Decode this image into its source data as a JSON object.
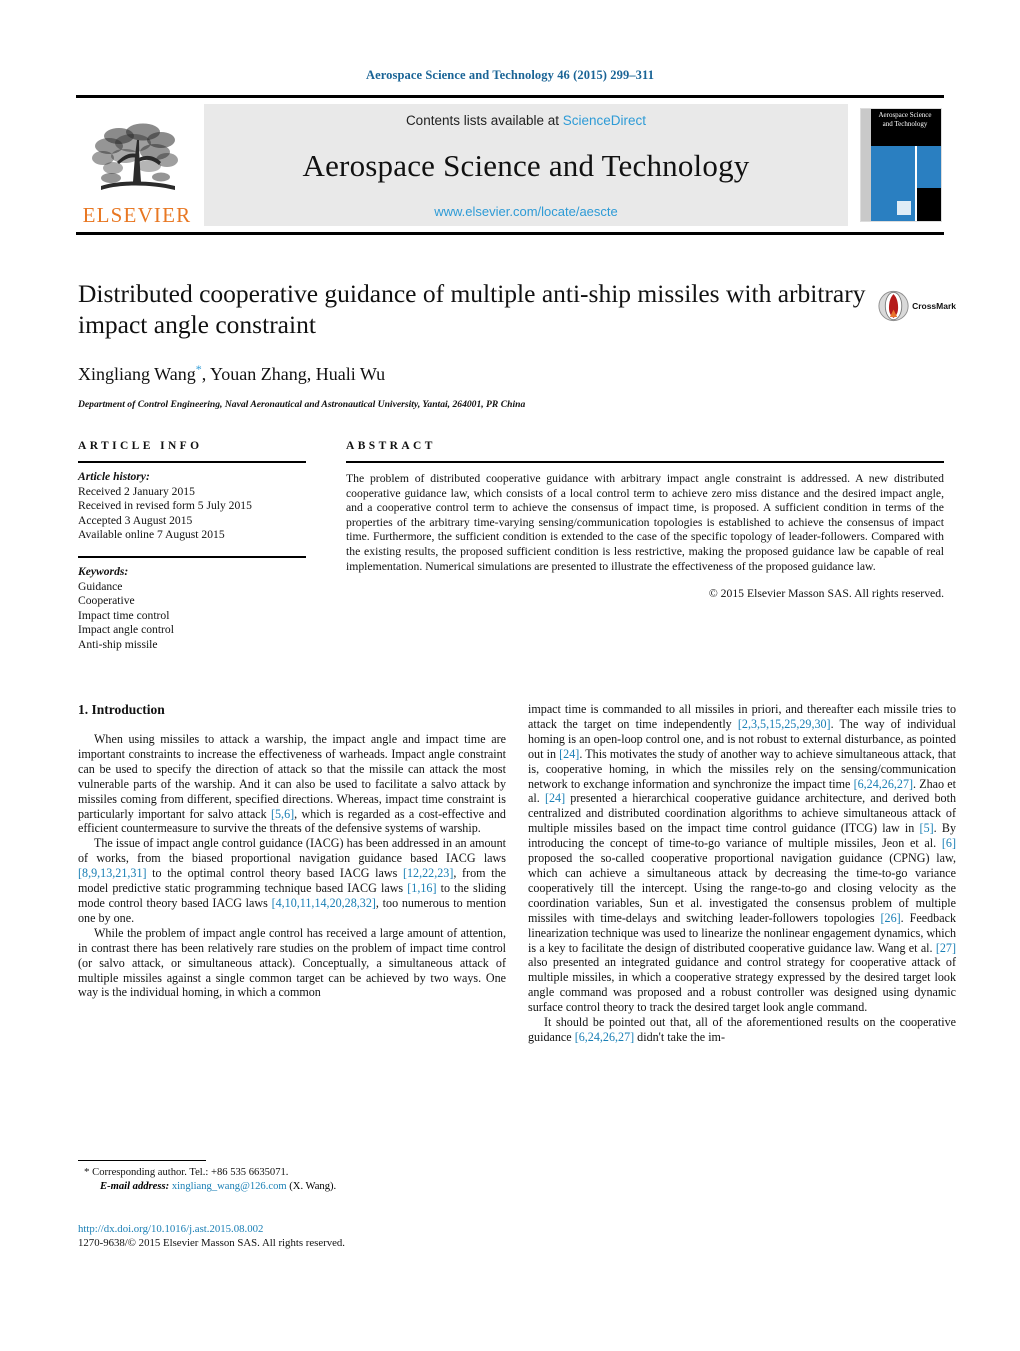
{
  "running_head": "Aerospace Science and Technology 46 (2015) 299–311",
  "masthead": {
    "publisher_name": "ELSEVIER",
    "contents_prefix": "Contents lists available at ",
    "sciencedirect": "ScienceDirect",
    "journal_title": "Aerospace Science and Technology",
    "journal_url": "www.elsevier.com/locate/aescte",
    "cover_title": "Aerospace Science and Technology"
  },
  "article": {
    "title": "Distributed cooperative guidance of multiple anti-ship missiles with arbitrary impact angle constraint",
    "authors": "Xingliang Wang, Youan Zhang, Huali Wu",
    "corresponding_marker": "*",
    "affiliation": "Department of Control Engineering, Naval Aeronautical and Astronautical University, Yantai, 264001, PR China",
    "crossmark_label": "CrossMark"
  },
  "article_info": {
    "heading": "ARTICLE INFO",
    "history_label": "Article history:",
    "history": [
      "Received 2 January 2015",
      "Received in revised form 5 July 2015",
      "Accepted 3 August 2015",
      "Available online 7 August 2015"
    ],
    "keywords_label": "Keywords:",
    "keywords": [
      "Guidance",
      "Cooperative",
      "Impact time control",
      "Impact angle control",
      "Anti-ship missile"
    ]
  },
  "abstract": {
    "heading": "ABSTRACT",
    "text": "The problem of distributed cooperative guidance with arbitrary impact angle constraint is addressed. A new distributed cooperative guidance law, which consists of a local control term to achieve zero miss distance and the desired impact angle, and a cooperative control term to achieve the consensus of impact time, is proposed. A sufficient condition in terms of the properties of the arbitrary time-varying sensing/communication topologies is established to achieve the consensus of impact time. Furthermore, the sufficient condition is extended to the case of the specific topology of leader-followers. Compared with the existing results, the proposed sufficient condition is less restrictive, making the proposed guidance law be capable of real implementation. Numerical simulations are presented to illustrate the effectiveness of the proposed guidance law.",
    "copyright": "© 2015 Elsevier Masson SAS. All rights reserved."
  },
  "introduction": {
    "heading": "1. Introduction",
    "left_paragraphs": [
      {
        "segments": [
          {
            "t": "When using missiles to attack a warship, the impact angle and impact time are important constraints to increase the effectiveness of warheads. Impact angle constraint can be used to specify the direction of attack so that the missile can attack the most vulnerable parts of the warship. And it can also be used to facilitate a salvo attack by missiles coming from different, specified directions. Whereas, impact time constraint is particularly important for salvo attack ",
            "ref": false
          },
          {
            "t": "[5,6]",
            "ref": true
          },
          {
            "t": ", which is regarded as a cost-effective and efficient countermeasure to survive the threats of the defensive systems of warship.",
            "ref": false
          }
        ]
      },
      {
        "segments": [
          {
            "t": "The issue of impact angle control guidance (IACG) has been addressed in an amount of works, from the biased proportional navigation guidance based IACG laws ",
            "ref": false
          },
          {
            "t": "[8,9,13,21,31]",
            "ref": true
          },
          {
            "t": " to the optimal control theory based IACG laws ",
            "ref": false
          },
          {
            "t": "[12,22,23]",
            "ref": true
          },
          {
            "t": ", from the model predictive static programming technique based IACG laws ",
            "ref": false
          },
          {
            "t": "[1,16]",
            "ref": true
          },
          {
            "t": " to the sliding mode control theory based IACG laws ",
            "ref": false
          },
          {
            "t": "[4,10,11,14,20,28,32]",
            "ref": true
          },
          {
            "t": ", too numerous to mention one by one.",
            "ref": false
          }
        ]
      },
      {
        "segments": [
          {
            "t": "While the problem of impact angle control has received a large amount of attention, in contrast there has been relatively rare studies on the problem of impact time control (or salvo attack, or simultaneous attack). Conceptually, a simultaneous attack of multiple missiles against a single common target can be achieved by two ways. One way is the individual homing, in which a common",
            "ref": false
          }
        ]
      }
    ],
    "right_paragraphs": [
      {
        "continued": true,
        "segments": [
          {
            "t": "impact time is commanded to all missiles in priori, and thereafter each missile tries to attack the target on time independently ",
            "ref": false
          },
          {
            "t": "[2,3,5,15,25,29,30]",
            "ref": true
          },
          {
            "t": ". The way of individual homing is an open-loop control one, and is not robust to external disturbance, as pointed out in ",
            "ref": false
          },
          {
            "t": "[24]",
            "ref": true
          },
          {
            "t": ". This motivates the study of another way to achieve simultaneous attack, that is, cooperative homing, in which the missiles rely on the sensing/communication network to exchange information and synchronize the impact time ",
            "ref": false
          },
          {
            "t": "[6,24,26,27]",
            "ref": true
          },
          {
            "t": ". Zhao et al. ",
            "ref": false
          },
          {
            "t": "[24]",
            "ref": true
          },
          {
            "t": " presented a hierarchical cooperative guidance architecture, and derived both centralized and distributed coordination algorithms to achieve simultaneous attack of multiple missiles based on the impact time control guidance (ITCG) law in ",
            "ref": false
          },
          {
            "t": "[5]",
            "ref": true
          },
          {
            "t": ". By introducing the concept of time-to-go variance of multiple missiles, Jeon et al. ",
            "ref": false
          },
          {
            "t": "[6]",
            "ref": true
          },
          {
            "t": " proposed the so-called cooperative proportional navigation guidance (CPNG) law, which can achieve a simultaneous attack by decreasing the time-to-go variance cooperatively till the intercept. Using the range-to-go and closing velocity as the coordination variables, Sun et al. investigated the consensus problem of multiple missiles with time-delays and switching leader-followers topologies ",
            "ref": false
          },
          {
            "t": "[26]",
            "ref": true
          },
          {
            "t": ". Feedback linearization technique was used to linearize the nonlinear engagement dynamics, which is a key to facilitate the design of distributed cooperative guidance law. Wang et al. ",
            "ref": false
          },
          {
            "t": "[27]",
            "ref": true
          },
          {
            "t": " also presented an integrated guidance and control strategy for cooperative attack of multiple missiles, in which a cooperative strategy expressed by the desired target look angle command was proposed and a robust controller was designed using dynamic surface control theory to track the desired target look angle command.",
            "ref": false
          }
        ]
      },
      {
        "continued": false,
        "segments": [
          {
            "t": "It should be pointed out that, all of the aforementioned results on the cooperative guidance ",
            "ref": false
          },
          {
            "t": "[6,24,26,27]",
            "ref": true
          },
          {
            "t": " didn't take the im-",
            "ref": false
          }
        ]
      }
    ]
  },
  "footnote": {
    "star": "*",
    "corresponding": "Corresponding author. Tel.: +86 535 6635071.",
    "email_label": "E-mail address:",
    "email": "xingliang_wang@126.com",
    "email_suffix": "(X. Wang).",
    "doi": "http://dx.doi.org/10.1016/j.ast.2015.08.002",
    "issn_line": "1270-9638/© 2015 Elsevier Masson SAS. All rights reserved."
  },
  "colors": {
    "link": "#1a7fb5",
    "sciencedirect": "#2e9bd6",
    "elsevier_orange": "#E87722",
    "cover_blue": "#2a7fc1"
  }
}
